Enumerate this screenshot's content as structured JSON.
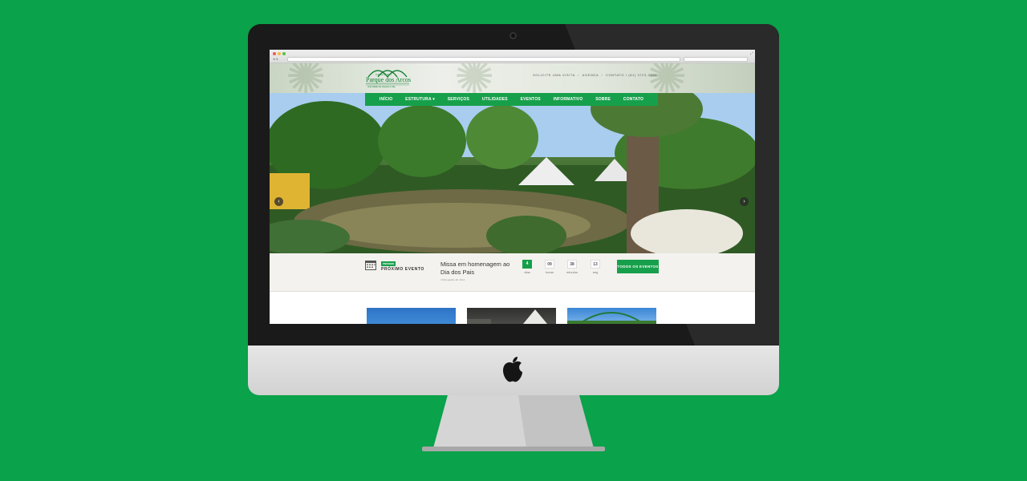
{
  "site": {
    "logo": {
      "subtitle_top": "CEMITÉRIO",
      "title": "Parque dos Arcos",
      "tagline": "uma cidade de respeito à vida"
    },
    "top_links": {
      "visit": "SOLICITE UMA VISITA",
      "agenda": "AGENDA",
      "contact": "CONTATO / (81) 3723-1888",
      "separator": "/"
    },
    "nav": [
      "INÍCIO",
      "ESTRUTURA ▾",
      "SERVIÇOS",
      "UTILIDADES",
      "EVENTOS",
      "INFORMATIVO",
      "SOBRE",
      "CONTATO"
    ],
    "slider": {
      "prev": "‹",
      "next": "›"
    },
    "event": {
      "badge": "PRÓXIMO",
      "label": "PRÓXIMO EVENTO",
      "title": "Missa em homenagem ao Dia dos Pais",
      "date": "10 de agosto de 2014",
      "countdown": [
        {
          "value": "4",
          "unit": "dias"
        },
        {
          "value": "09",
          "unit": "horas"
        },
        {
          "value": "38",
          "unit": "minutos"
        },
        {
          "value": "13",
          "unit": "seg"
        }
      ],
      "button": "TODOS OS EVENTOS"
    }
  },
  "colors": {
    "background": "#0aa24a",
    "brand_green": "#17a04b",
    "bezel": "#1a1a1a"
  },
  "icons": [
    "camera-icon",
    "apple-logo-icon",
    "calendar-icon",
    "chevron-left-icon",
    "chevron-right-icon"
  ]
}
